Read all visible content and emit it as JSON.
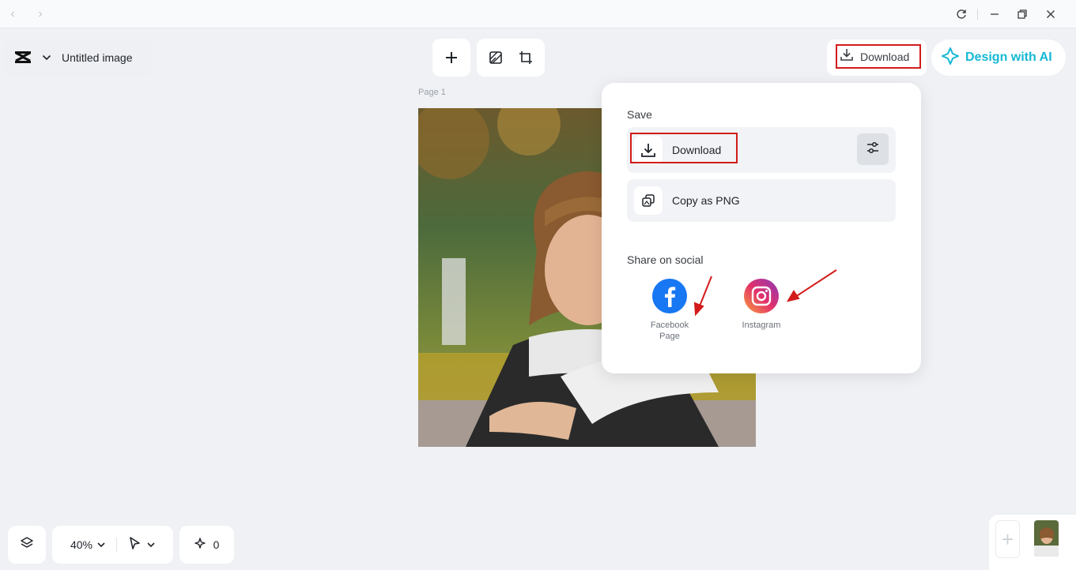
{
  "window": {
    "back_icon": "chevron-left-icon",
    "forward_icon": "chevron-right-icon",
    "controls": [
      "refresh-icon",
      "minimize-icon",
      "restore-icon",
      "close-icon"
    ]
  },
  "header": {
    "doc_title": "Untitled image",
    "download_label": "Download",
    "design_ai_label": "Design with AI",
    "accent_color": "#14b8d4"
  },
  "toolbar": {
    "icons": [
      "plus-icon",
      "background-icon",
      "resize-icon"
    ]
  },
  "canvas": {
    "page_label": "Page 1"
  },
  "popover": {
    "save_title": "Save",
    "download_label": "Download",
    "copy_label": "Copy as PNG",
    "share_title": "Share on social",
    "social": [
      {
        "label_line1": "Facebook",
        "label_line2": "Page",
        "color": "#1877f2"
      },
      {
        "label_line1": "Instagram",
        "label_line2": "",
        "color": "#e1306c"
      }
    ]
  },
  "bottom": {
    "zoom": "40%",
    "count": "0"
  },
  "annotation_color": "#d31b1b"
}
